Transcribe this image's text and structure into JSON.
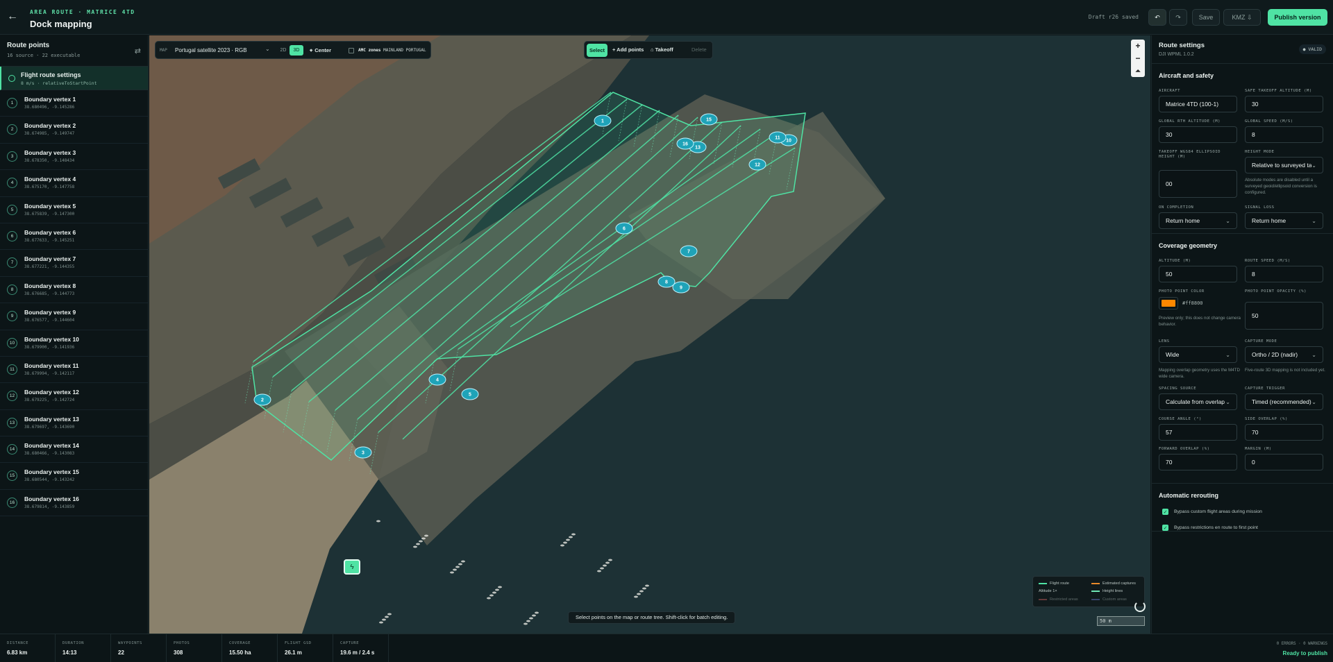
{
  "header": {
    "eyebrow": "AREA ROUTE · MATRICE 4TD",
    "title": "Dock mapping",
    "draft_status": "Draft r26 saved",
    "save_label": "Save",
    "kmz_label": "KMZ",
    "publish_label": "Publish version"
  },
  "route_points": {
    "title": "Route points",
    "subtitle": "16 source · 22 executable",
    "settings_item": {
      "title": "Flight route settings",
      "subtitle": "8 m/s · relativeToStartPoint"
    },
    "vertices": [
      {
        "num": "1",
        "name": "Boundary vertex 1",
        "coord": "38.680496, -9.145286"
      },
      {
        "num": "2",
        "name": "Boundary vertex 2",
        "coord": "38.674985, -9.149747"
      },
      {
        "num": "3",
        "name": "Boundary vertex 3",
        "coord": "38.678350, -9.148434"
      },
      {
        "num": "4",
        "name": "Boundary vertex 4",
        "coord": "38.675170, -9.147758"
      },
      {
        "num": "5",
        "name": "Boundary vertex 5",
        "coord": "38.675839, -9.147300"
      },
      {
        "num": "6",
        "name": "Boundary vertex 6",
        "coord": "38.677633, -9.145251"
      },
      {
        "num": "7",
        "name": "Boundary vertex 7",
        "coord": "38.677221, -9.144355"
      },
      {
        "num": "8",
        "name": "Boundary vertex 8",
        "coord": "38.676685, -9.144773"
      },
      {
        "num": "9",
        "name": "Boundary vertex 9",
        "coord": "38.676577, -9.144604"
      },
      {
        "num": "10",
        "name": "Boundary vertex 10",
        "coord": "38.679900, -9.141936"
      },
      {
        "num": "11",
        "name": "Boundary vertex 11",
        "coord": "38.679994, -9.142117"
      },
      {
        "num": "12",
        "name": "Boundary vertex 12",
        "coord": "38.679225, -9.142724"
      },
      {
        "num": "13",
        "name": "Boundary vertex 13",
        "coord": "38.679697, -9.143690"
      },
      {
        "num": "14",
        "name": "Boundary vertex 14",
        "coord": "38.680466, -9.143083"
      },
      {
        "num": "15",
        "name": "Boundary vertex 15",
        "coord": "38.680544, -9.143242"
      },
      {
        "num": "16",
        "name": "Boundary vertex 16",
        "coord": "38.679814, -9.143859"
      }
    ]
  },
  "map": {
    "label": "MAP",
    "layer": "Portugal satellite 2023 · RGB",
    "mode_2d": "2D",
    "mode_3d": "3D",
    "center_label": "Center",
    "amc_label": "AMC zones",
    "amc_region": "MAINLAND PORTUGAL",
    "tools": {
      "select": "Select",
      "add": "+ Add points",
      "takeoff": "⌂ Takeoff",
      "delete": "Delete"
    },
    "hint": "Select points on the map or route tree. Shift-click for batch editing.",
    "scale": "50 m",
    "legend": [
      {
        "label": "Flight route",
        "color": "#4fe3a4"
      },
      {
        "label": "Estimated captures",
        "color": "#e8892a"
      },
      {
        "label": "Altitude 1×",
        "color": "#4fe3a4"
      },
      {
        "label": "Height lines",
        "color": "#6fe6b6"
      },
      {
        "label": "Restricted areas",
        "color": "#c96060"
      },
      {
        "label": "Custom areas",
        "color": "#6b7bd0"
      }
    ],
    "markers": [
      "1",
      "2",
      "3",
      "4",
      "5",
      "6",
      "7",
      "8",
      "9",
      "10",
      "11",
      "12",
      "13",
      "16",
      "15"
    ]
  },
  "settings": {
    "title": "Route settings",
    "subtitle": "DJI WPML 1.0.2",
    "valid": "VALID",
    "aircraft_safety": {
      "title": "Aircraft and safety",
      "aircraft_label": "AIRCRAFT",
      "aircraft": "Matrice 4TD (100-1)",
      "safe_takeoff_label": "SAFE TAKEOFF ALTITUDE (M)",
      "safe_takeoff": "30",
      "global_rth_label": "GLOBAL RTH ALTITUDE (M)",
      "global_rth": "30",
      "global_speed_label": "GLOBAL SPEED (M/S)",
      "global_speed": "8",
      "ellipsoid_label": "TAKEOFF WGS84 ELLIPSOID HEIGHT (M)",
      "ellipsoid": "00",
      "height_mode_label": "HEIGHT MODE",
      "height_mode": "Relative to surveyed take",
      "height_mode_note": "Absolute modes are disabled until a surveyed geoid/ellipsoid conversion is configured.",
      "on_completion_label": "ON COMPLETION",
      "on_completion": "Return home",
      "signal_loss_label": "SIGNAL LOSS",
      "signal_loss": "Return home"
    },
    "coverage": {
      "title": "Coverage geometry",
      "altitude_label": "ALTITUDE (M)",
      "altitude": "50",
      "route_speed_label": "ROUTE SPEED (M/S)",
      "route_speed": "8",
      "photo_color_label": "PHOTO POINT COLOR",
      "photo_color": "#ff8800",
      "photo_color_text": "#ff8800",
      "photo_opacity_label": "PHOTO POINT OPACITY (%)",
      "photo_opacity": "50",
      "photo_note": "Preview only; this does not change camera behavior.",
      "lens_label": "LENS",
      "lens": "Wide",
      "lens_note": "Mapping overlap geometry uses the M4TD wide camera.",
      "capture_mode_label": "CAPTURE MODE",
      "capture_mode": "Ortho / 2D (nadir)",
      "capture_mode_note": "Five-route 3D mapping is not included yet.",
      "spacing_label": "SPACING SOURCE",
      "spacing": "Calculate from overlap",
      "trigger_label": "CAPTURE TRIGGER",
      "trigger": "Timed (recommended)",
      "course_label": "COURSE ANGLE (°)",
      "course": "57",
      "side_overlap_label": "SIDE OVERLAP (%)",
      "side_overlap": "70",
      "forward_overlap_label": "FORWARD OVERLAP (%)",
      "forward_overlap": "70",
      "margin_label": "MARGIN (M)",
      "margin": "0"
    },
    "rerouting": {
      "title": "Automatic rerouting",
      "opt1": "Bypass custom flight areas during mission",
      "opt2": "Bypass restrictions en route to first point"
    }
  },
  "footer": {
    "stats": [
      {
        "label": "DISTANCE",
        "value": "6.83 km"
      },
      {
        "label": "DURATION",
        "value": "14:13"
      },
      {
        "label": "WAYPOINTS",
        "value": "22"
      },
      {
        "label": "PHOTOS",
        "value": "308"
      },
      {
        "label": "COVERAGE",
        "value": "15.50 ha"
      },
      {
        "label": "FLIGHT GSD",
        "value": "26.1 m"
      },
      {
        "label": "CAPTURE",
        "value": "19.6 m / 2.4 s"
      }
    ],
    "errors": "0 ERRORS · 0 WARNINGS",
    "ready": "Ready to publish"
  }
}
